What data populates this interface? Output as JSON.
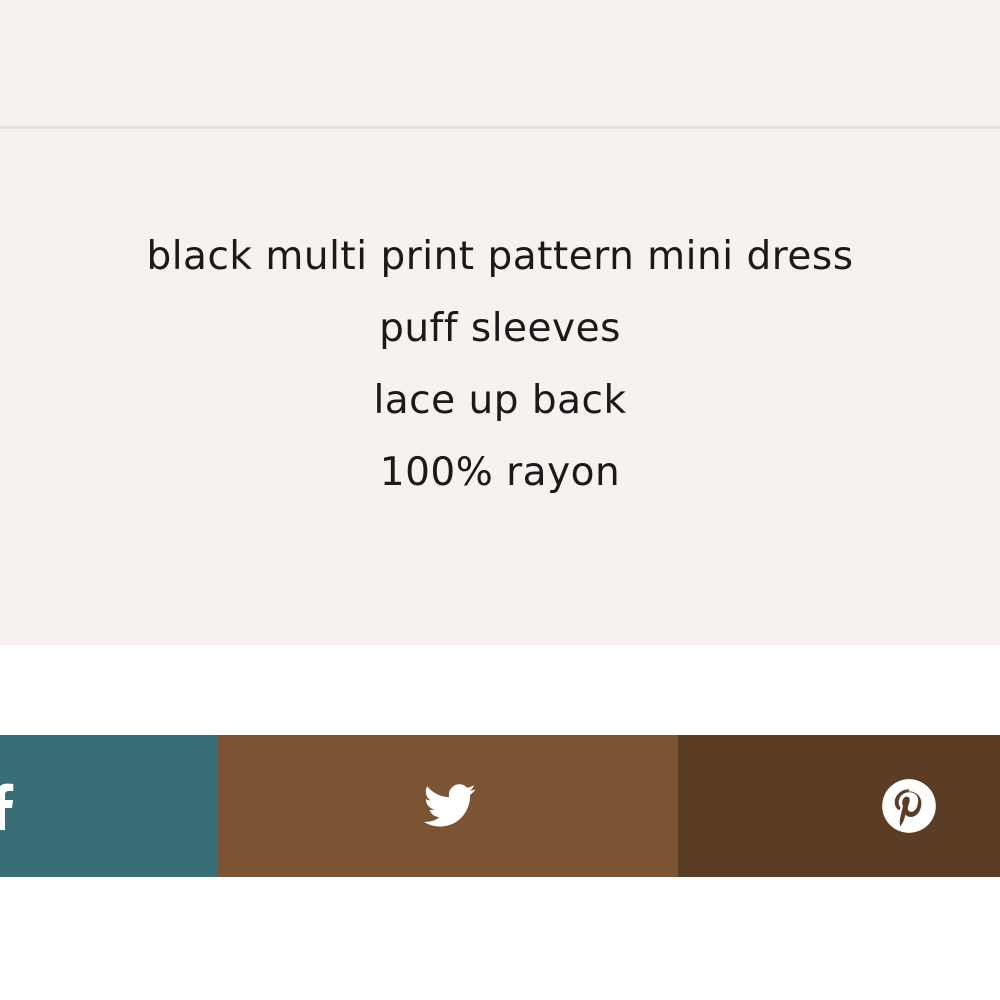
{
  "description": {
    "lines": [
      "black multi print pattern mini dress",
      "puff sleeves",
      "lace up back",
      "100% rayon"
    ]
  },
  "share": {
    "buttons": [
      {
        "name": "facebook",
        "icon": "facebook-icon",
        "color": "#386e75"
      },
      {
        "name": "twitter",
        "icon": "twitter-icon",
        "color": "#7a5433"
      },
      {
        "name": "pinterest",
        "icon": "pinterest-icon",
        "color": "#5b3c24"
      }
    ]
  },
  "colors": {
    "page_background": "#ffffff",
    "band_background": "#f7f2ef",
    "divider": "#e6e1de",
    "text": "#1a1a1a"
  }
}
